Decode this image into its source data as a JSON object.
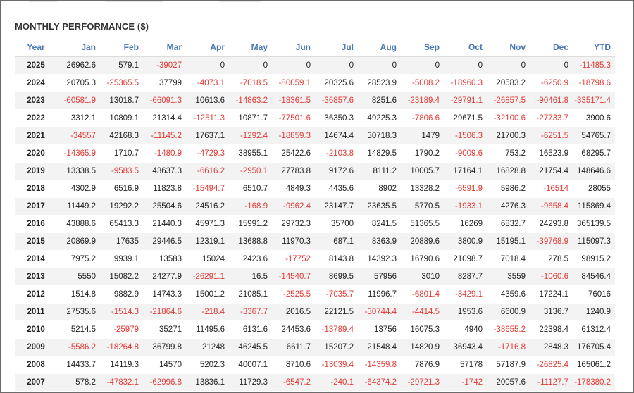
{
  "title": "MONTHLY PERFORMANCE ($)",
  "columns": [
    "Year",
    "Jan",
    "Feb",
    "Mar",
    "Apr",
    "May",
    "Jun",
    "Jul",
    "Aug",
    "Sep",
    "Oct",
    "Nov",
    "Dec",
    "YTD"
  ],
  "rows": [
    [
      "2025",
      "26962.6",
      "579.1",
      "-39027",
      "0",
      "0",
      "0",
      "0",
      "0",
      "0",
      "0",
      "0",
      "0",
      "-11485.3"
    ],
    [
      "2024",
      "20705.3",
      "-25365.5",
      "37799",
      "-4073.1",
      "-7018.5",
      "-80059.1",
      "20325.6",
      "28523.9",
      "-5008.2",
      "-18960.3",
      "20583.2",
      "-6250.9",
      "-18798.6"
    ],
    [
      "2023",
      "-60581.9",
      "13018.7",
      "-66091.3",
      "10613.6",
      "-14863.2",
      "-18361.5",
      "-36857.6",
      "8251.6",
      "-23189.4",
      "-29791.1",
      "-26857.5",
      "-90461.8",
      "-335171.4"
    ],
    [
      "2022",
      "3312.1",
      "10809.1",
      "21314.4",
      "-12511.3",
      "10871.7",
      "-77501.6",
      "36350.3",
      "49225.3",
      "-7806.6",
      "29671.5",
      "-32100.6",
      "-27733.7",
      "3900.6"
    ],
    [
      "2021",
      "-34557",
      "42168.3",
      "-11145.2",
      "17637.1",
      "-1292.4",
      "-18859.3",
      "14674.4",
      "30718.3",
      "1479",
      "-1506.3",
      "21700.3",
      "-6251.5",
      "54765.7"
    ],
    [
      "2020",
      "-14365.9",
      "1710.7",
      "-1480.9",
      "-4729.3",
      "38955.1",
      "25422.6",
      "-2103.8",
      "14829.5",
      "1790.2",
      "-9009.6",
      "753.2",
      "16523.9",
      "68295.7"
    ],
    [
      "2019",
      "13338.5",
      "-9583.5",
      "43637.3",
      "-6616.2",
      "-2950.1",
      "27783.8",
      "9172.6",
      "8111.2",
      "10005.7",
      "17164.1",
      "16828.8",
      "21754.4",
      "148646.6"
    ],
    [
      "2018",
      "4302.9",
      "6516.9",
      "11823.8",
      "-15494.7",
      "6510.7",
      "4849.3",
      "4435.6",
      "8902",
      "13328.2",
      "-6591.9",
      "5986.2",
      "-16514",
      "28055"
    ],
    [
      "2017",
      "11449.2",
      "19292.2",
      "25504.6",
      "24516.2",
      "-168.9",
      "-9962.4",
      "23147.7",
      "23635.5",
      "5770.5",
      "-1933.1",
      "4276.3",
      "-9658.4",
      "115869.4"
    ],
    [
      "2016",
      "43888.6",
      "65413.3",
      "21440.3",
      "45971.3",
      "15991.2",
      "29732.3",
      "35700",
      "8241.5",
      "51365.5",
      "16269",
      "6832.7",
      "24293.8",
      "365139.5"
    ],
    [
      "2015",
      "20869.9",
      "17635",
      "29446.5",
      "12319.1",
      "13688.8",
      "11970.3",
      "687.1",
      "8363.9",
      "20889.6",
      "3800.9",
      "15195.1",
      "-39768.9",
      "115097.3"
    ],
    [
      "2014",
      "7975.2",
      "9939.1",
      "13583",
      "15024",
      "2423.6",
      "-17752",
      "8143.8",
      "14392.3",
      "16790.6",
      "21098.7",
      "7018.4",
      "278.5",
      "98915.2"
    ],
    [
      "2013",
      "5550",
      "15082.2",
      "24277.9",
      "-26291.1",
      "16.5",
      "-14540.7",
      "8699.5",
      "57956",
      "3010",
      "8287.7",
      "3559",
      "-1060.6",
      "84546.4"
    ],
    [
      "2012",
      "1514.8",
      "9882.9",
      "14743.3",
      "15001.2",
      "21085.1",
      "-2525.5",
      "-7035.7",
      "11996.7",
      "-6801.4",
      "-3429.1",
      "4359.6",
      "17224.1",
      "76016"
    ],
    [
      "2011",
      "27535.6",
      "-1514.3",
      "-21864.6",
      "-218.4",
      "-3367.7",
      "2016.5",
      "22121.5",
      "-30744.4",
      "-4414.5",
      "1953.6",
      "6600.9",
      "3136.7",
      "1240.9"
    ],
    [
      "2010",
      "5214.5",
      "-25979",
      "35271",
      "11495.6",
      "6131.6",
      "24453.6",
      "-13789.4",
      "13756",
      "16075.3",
      "4940",
      "-38655.2",
      "22398.4",
      "61312.4"
    ],
    [
      "2009",
      "-5586.2",
      "-18264.8",
      "36799.8",
      "21248",
      "46245.5",
      "6611.7",
      "15207.2",
      "21548.4",
      "14820.9",
      "36943.4",
      "-1716.8",
      "2848.3",
      "176705.4"
    ],
    [
      "2008",
      "14433.7",
      "14119.3",
      "14570",
      "5202.3",
      "40007.1",
      "8710.6",
      "-13039.4",
      "-14359.8",
      "7876.9",
      "57178",
      "57187.9",
      "-26825.4",
      "165061.2"
    ],
    [
      "2007",
      "578.2",
      "-47832.1",
      "-62996.8",
      "13836.1",
      "11729.3",
      "-6547.2",
      "-240.1",
      "-64374.2",
      "-29721.3",
      "-1742",
      "20057.6",
      "-11127.7",
      "-178380.2"
    ]
  ],
  "colors": {
    "header_text": "#4a78b5",
    "negative": "#e53935",
    "row_alt": "#f3f3f3"
  }
}
